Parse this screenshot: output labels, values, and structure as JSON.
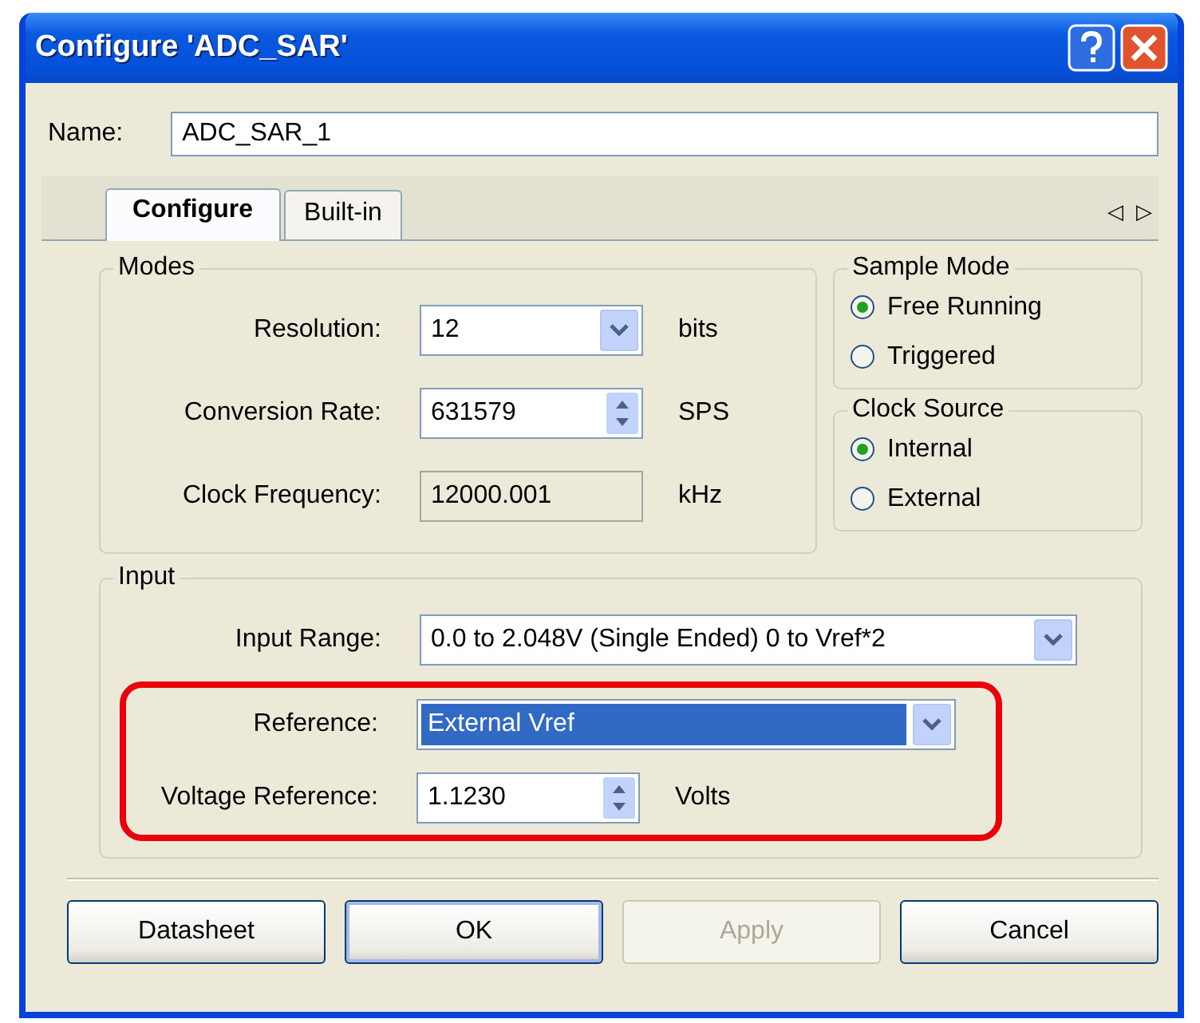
{
  "window": {
    "title": "Configure 'ADC_SAR'"
  },
  "name_field": {
    "label": "Name:",
    "value": "ADC_SAR_1"
  },
  "tabs": [
    {
      "label": "Configure",
      "selected": true
    },
    {
      "label": "Built-in",
      "selected": false
    }
  ],
  "tab_scroll": {
    "left": "◁",
    "right": "▷"
  },
  "modes": {
    "title": "Modes",
    "fields": [
      {
        "kind": "dropdown",
        "label": "Resolution:",
        "value": "12",
        "unit": "bits"
      },
      {
        "kind": "spin",
        "label": "Conversion Rate:",
        "value": "631579",
        "unit": "SPS"
      },
      {
        "kind": "readonly",
        "label": "Clock Frequency:",
        "value": "12000.001",
        "unit": "kHz"
      }
    ]
  },
  "sample_mode": {
    "title": "Sample Mode",
    "options": [
      {
        "label": "Free Running",
        "selected": true
      },
      {
        "label": "Triggered",
        "selected": false
      }
    ]
  },
  "clock_source": {
    "title": "Clock Source",
    "options": [
      {
        "label": "Internal",
        "selected": true
      },
      {
        "label": "External",
        "selected": false
      }
    ]
  },
  "input": {
    "title": "Input",
    "fields": [
      {
        "kind": "dropdown",
        "label": "Input Range:",
        "value": "0.0 to 2.048V (Single Ended) 0 to Vref*2",
        "highlighted": false,
        "wide": true
      },
      {
        "kind": "dropdown",
        "label": "Reference:",
        "value": "External Vref",
        "highlighted": true,
        "marked": true
      },
      {
        "kind": "spin",
        "label": "Voltage Reference:",
        "value": "1.1230",
        "unit": "Volts",
        "marked": true
      }
    ]
  },
  "buttons": [
    {
      "label": "Datasheet",
      "disabled": false,
      "default": false
    },
    {
      "label": "OK",
      "disabled": false,
      "default": true
    },
    {
      "label": "Apply",
      "disabled": true,
      "default": false
    },
    {
      "label": "Cancel",
      "disabled": false,
      "default": false
    }
  ]
}
